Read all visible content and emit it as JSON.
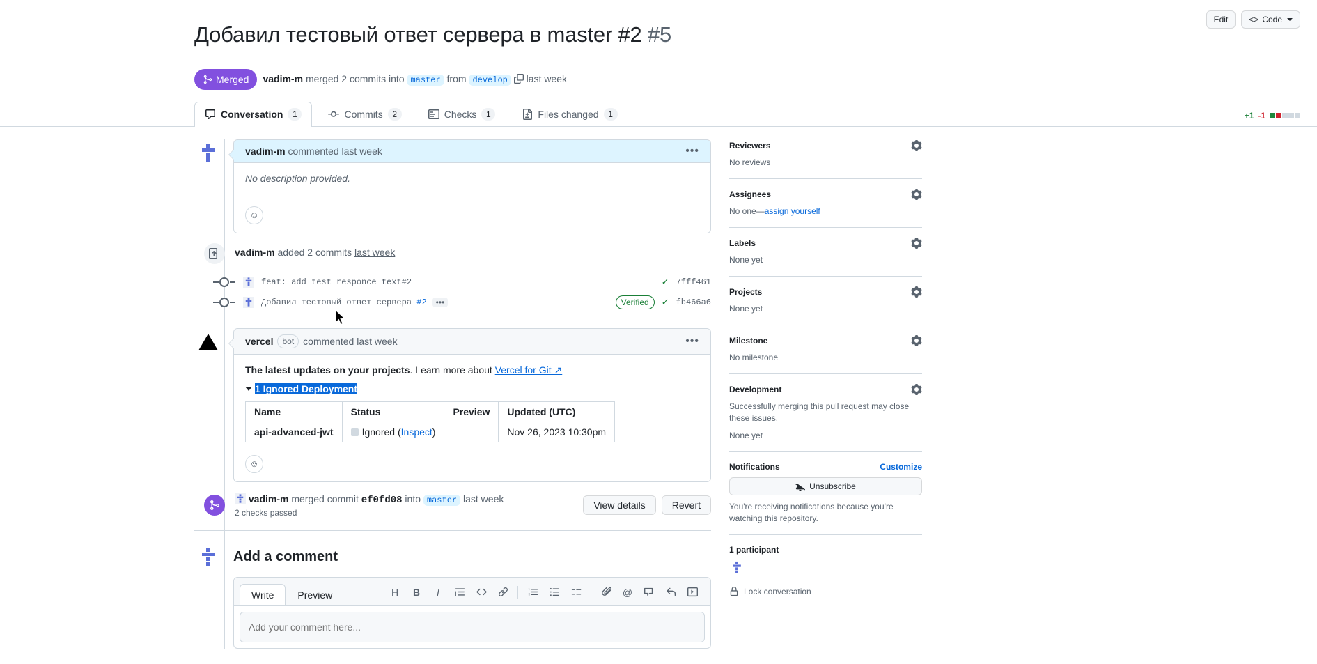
{
  "header": {
    "title_text": "Добавил тестовый ответ сервера в master #2",
    "title_number": "#5",
    "edit_label": "Edit",
    "code_label": "Code",
    "state": "Merged",
    "author": "vadim-m",
    "merge_phrase": "merged 2 commits into",
    "base_branch": "master",
    "from_word": "from",
    "head_branch": "develop",
    "when": "last week"
  },
  "tabs": [
    {
      "label": "Conversation",
      "count": "1",
      "icon": "comment-icon",
      "active": true
    },
    {
      "label": "Commits",
      "count": "2",
      "icon": "commit-icon",
      "active": false
    },
    {
      "label": "Checks",
      "count": "1",
      "icon": "checklist-icon",
      "active": false
    },
    {
      "label": "Files changed",
      "count": "1",
      "icon": "file-diff-icon",
      "active": false
    }
  ],
  "diffstat": {
    "additions": "+1",
    "deletions": "-1"
  },
  "first_comment": {
    "author": "vadim-m",
    "action": "commented",
    "when": "last week",
    "body": "No description provided."
  },
  "commits_event": {
    "author": "vadim-m",
    "text": "added 2 commits",
    "when": "last week"
  },
  "commits": [
    {
      "message": "feat: add test responce text#2",
      "ref": "",
      "verified": "",
      "sha": "7fff461"
    },
    {
      "message": "Добавил тестовый ответ сервера",
      "ref": "#2",
      "verified": "Verified",
      "sha": "fb466a6"
    }
  ],
  "bot_comment": {
    "author": "vercel",
    "tag": "bot",
    "action": "commented",
    "when": "last week",
    "intro_bold": "The latest updates on your projects",
    "intro_rest": ". Learn more about ",
    "intro_link": "Vercel for Git ↗",
    "disclosure_label": "1 Ignored Deployment",
    "table": {
      "headers": [
        "Name",
        "Status",
        "Preview",
        "Updated (UTC)"
      ],
      "rows": [
        {
          "name": "api-advanced-jwt",
          "status_text": "Ignored (",
          "status_link": "Inspect",
          "status_close": ")",
          "preview": "",
          "updated": "Nov 26, 2023 10:30pm"
        }
      ]
    }
  },
  "merge_event": {
    "author": "vadim-m",
    "text_a": "merged commit",
    "commit_sha": "ef0fd08",
    "text_b": "into",
    "branch": "master",
    "when": "last week",
    "checks_note": "2 checks passed",
    "view_details": "View details",
    "revert": "Revert"
  },
  "add_comment": {
    "heading": "Add a comment",
    "tabs": [
      {
        "label": "Write",
        "active": true
      },
      {
        "label": "Preview",
        "active": false
      }
    ],
    "placeholder": "Add your comment here...",
    "toolbar_icons": [
      "heading-icon",
      "bold-icon",
      "italic-icon",
      "quote-icon",
      "code-icon",
      "link-icon",
      "ordered-list-icon",
      "unordered-list-icon",
      "task-list-icon",
      "attach-icon",
      "mention-icon",
      "reference-icon",
      "reply-icon",
      "saved-reply-icon"
    ]
  },
  "sidebar": {
    "reviewers": {
      "title": "Reviewers",
      "body": "No reviews"
    },
    "assignees": {
      "title": "Assignees",
      "body_a": "No one—",
      "link": "assign yourself"
    },
    "labels": {
      "title": "Labels",
      "body": "None yet"
    },
    "projects": {
      "title": "Projects",
      "body": "None yet"
    },
    "milestone": {
      "title": "Milestone",
      "body": "No milestone"
    },
    "development": {
      "title": "Development",
      "body": "Successfully merging this pull request may close these issues.",
      "body2": "None yet"
    },
    "notifications": {
      "title": "Notifications",
      "customize": "Customize",
      "button": "Unsubscribe",
      "note": "You're receiving notifications because you're watching this repository."
    },
    "participants": {
      "title": "1 participant"
    },
    "lock": "Lock conversation"
  },
  "colors": {
    "merged_purple": "#8250df",
    "link_blue": "#0969da",
    "green": "#1a7f37",
    "red": "#cf222e",
    "border": "#d1d9e0",
    "muted": "#59636e",
    "comment_head": "#ddf4ff"
  }
}
